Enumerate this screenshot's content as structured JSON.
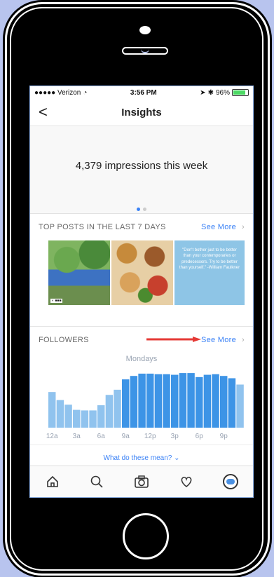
{
  "status": {
    "carrier": "●●●●● Verizon",
    "time": "3:56 PM",
    "battery": "96%",
    "battery_level": 0.96
  },
  "nav": {
    "back": "<",
    "title": "Insights"
  },
  "impressions": {
    "text": "4,379 impressions this week",
    "page_count": 2,
    "active_page": 0
  },
  "top_posts": {
    "header": "TOP POSTS IN THE LAST 7 DAYS",
    "see_more": "See More",
    "chevron": "›",
    "quote": "\"Don't bother just to be better than your contemporaries or predecessors. Try to be better than yourself.\" -William Faulkner"
  },
  "followers": {
    "header": "FOLLOWERS",
    "see_more": "See More",
    "chevron": "›",
    "note": "What do these mean? ⌄"
  },
  "chart_data": {
    "type": "bar",
    "title": "Mondays",
    "categories": [
      "12a",
      "1a",
      "2a",
      "3a",
      "4a",
      "5a",
      "6a",
      "7a",
      "8a",
      "9a",
      "10a",
      "11a",
      "12p",
      "1p",
      "2p",
      "3p",
      "4p",
      "5p",
      "6p",
      "7p",
      "8p",
      "9p",
      "10p",
      "11p"
    ],
    "tick_labels": [
      "12a",
      "3a",
      "6a",
      "9a",
      "12p",
      "3p",
      "6p",
      "9p"
    ],
    "values": [
      62,
      48,
      40,
      31,
      30,
      30,
      39,
      57,
      66,
      84,
      90,
      94,
      94,
      93,
      93,
      92,
      95,
      95,
      88,
      92,
      93,
      90,
      86,
      75
    ],
    "colors_light": "#90c3ee",
    "colors_dark": "#3d94e6",
    "ylim": [
      0,
      100
    ]
  },
  "tabbar": {
    "icons": [
      "home-icon",
      "search-icon",
      "camera-icon",
      "heart-icon",
      "profile-avatar"
    ]
  },
  "colors": {
    "accent": "#3b82f6",
    "arrow": "#e53935",
    "page_bg": "#b8c4ee"
  }
}
